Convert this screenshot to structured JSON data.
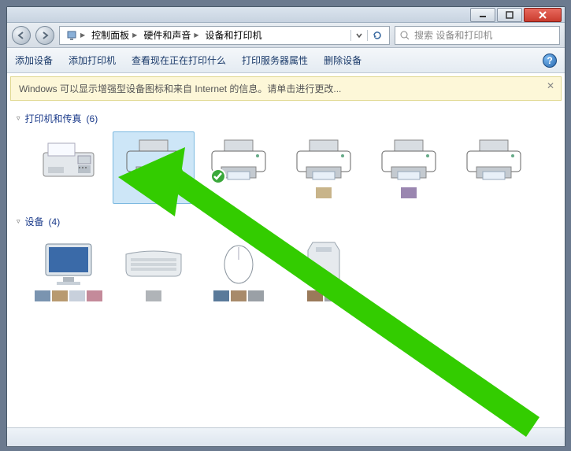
{
  "window": {
    "min_tip": "最小化",
    "max_tip": "最大化",
    "close_tip": "关闭"
  },
  "breadcrumb": {
    "root_icon": "computer-icon",
    "seg1": "控制面板",
    "seg2": "硬件和声音",
    "seg3": "设备和打印机"
  },
  "search": {
    "placeholder": "搜索 设备和打印机"
  },
  "toolbar": {
    "add_device": "添加设备",
    "add_printer": "添加打印机",
    "see_printing": "查看现在正在打印什么",
    "print_server_props": "打印服务器属性",
    "remove_device": "删除设备"
  },
  "info": {
    "text": "Windows 可以显示增强型设备图标和来自 Internet 的信息。请单击进行更改..."
  },
  "groups": {
    "printers": {
      "label": "打印机和传真",
      "count": "(6)"
    },
    "devices": {
      "label": "设备",
      "count": "(4)"
    }
  },
  "printer_items": [
    {
      "kind": "fax",
      "default": false,
      "swatches": []
    },
    {
      "kind": "printer",
      "default": false,
      "swatches": [],
      "selected": true
    },
    {
      "kind": "printer",
      "default": true,
      "swatches": []
    },
    {
      "kind": "printer",
      "default": false,
      "swatches": [
        "#c8b48a"
      ]
    },
    {
      "kind": "printer",
      "default": false,
      "swatches": [
        "#9a86b0"
      ]
    },
    {
      "kind": "printer",
      "default": false,
      "swatches": []
    }
  ],
  "device_items": [
    {
      "kind": "monitor",
      "swatches": [
        "#7a94b0",
        "#b89a70",
        "#c8d0dc",
        "#c48a9a"
      ]
    },
    {
      "kind": "keyboard",
      "swatches": [
        "#b0b4b8"
      ]
    },
    {
      "kind": "mouse",
      "swatches": [
        "#5a7a9a",
        "#a88a6a",
        "#9aa0a6"
      ]
    },
    {
      "kind": "drive",
      "swatches": [
        "#9a7a5a",
        "#a0a4a8"
      ]
    }
  ],
  "colors": {
    "accent": "#1a3a8a",
    "selection": "#cde6f7",
    "info_bg": "#fdf7d8",
    "arrow": "#33cc00"
  }
}
